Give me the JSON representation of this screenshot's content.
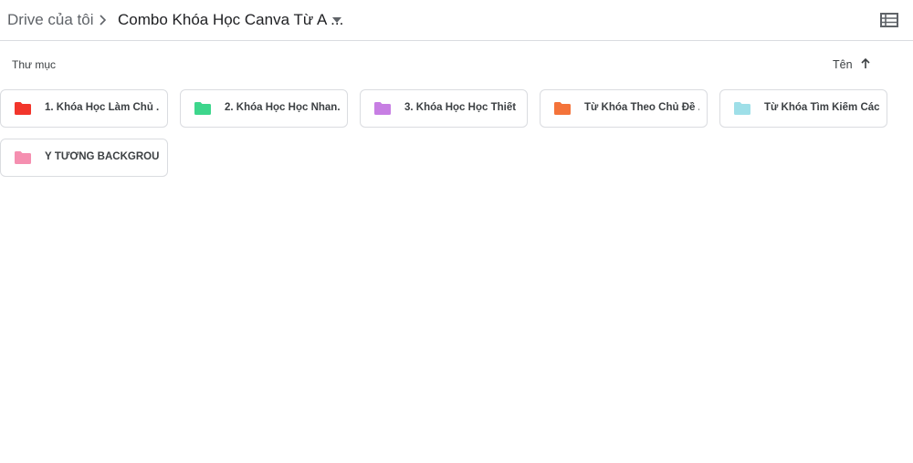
{
  "breadcrumb": {
    "root": "Drive của tôi",
    "current": "Combo Khóa Học Canva Từ A ..."
  },
  "toolbar": {
    "view_icon": "list-view-icon"
  },
  "folders_section": {
    "label": "Thư mục",
    "sort_label": "Tên",
    "sort_icon": "arrow-up-icon"
  },
  "folders": [
    {
      "name": "1. Khóa Học Làm Chủ ...",
      "color": "#f2352b"
    },
    {
      "name": "2. Khóa Học Học Nhan...",
      "color": "#3dd68c"
    },
    {
      "name": "3. Khóa Học Học Thiết ...",
      "color": "#c77ee3"
    },
    {
      "name": "Từ Khóa Theo Chủ Đề ...",
      "color": "#f4733a"
    },
    {
      "name": "Từ Khóa Tìm Kiếm Các...",
      "color": "#9edfe8"
    },
    {
      "name": "Ý TƯỞNG BACKGROUN...",
      "color": "#f58fb0"
    }
  ]
}
